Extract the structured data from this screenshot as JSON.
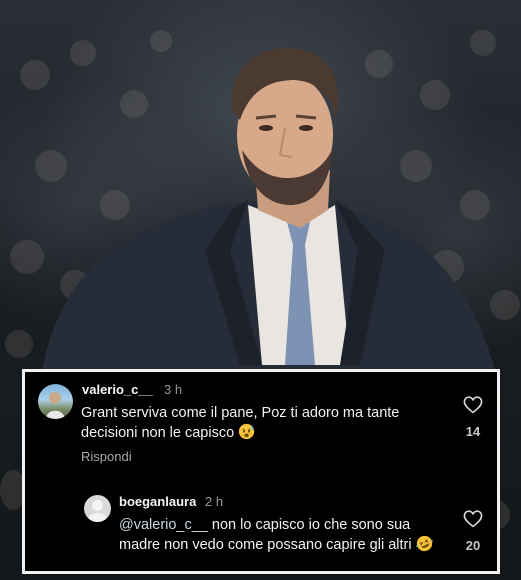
{
  "comments": [
    {
      "username": "valerio_c__",
      "time": "3 h",
      "text": "Grant serviva come il pane, Poz ti adoro ma tante decisioni non le capisco",
      "likes": "14",
      "reply_label": "Rispondi",
      "emoji": "face-with-open-mouth-and-sweat"
    },
    {
      "username": "boeganlaura",
      "time": "2 h",
      "mention": "@valerio_c__",
      "text": " non lo capisco io che sono sua madre non vedo come possano capire gli altri",
      "likes": "20",
      "emoji": "rolling-on-the-floor-laughing"
    }
  ],
  "colors": {
    "card_background": "#000000",
    "card_border": "#f2f2f2",
    "text": "#f2f2f2",
    "muted": "#9a9a9a"
  }
}
